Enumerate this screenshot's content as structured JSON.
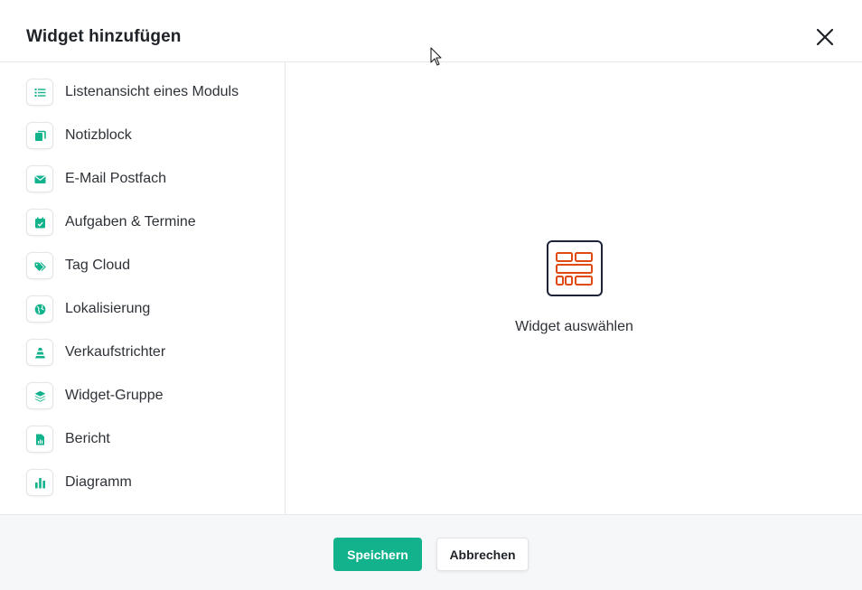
{
  "dialog": {
    "title": "Widget hinzufügen",
    "close_icon": "close-icon"
  },
  "colors": {
    "accent": "#12b28c",
    "widget_icon_orange": "#e04a12",
    "widget_icon_border": "#1d2338"
  },
  "sidebar": {
    "items": [
      {
        "label": "Listenansicht eines Moduls",
        "icon": "list-icon"
      },
      {
        "label": "Notizblock",
        "icon": "notes-icon"
      },
      {
        "label": "E-Mail Postfach",
        "icon": "envelope-icon"
      },
      {
        "label": "Aufgaben & Termine",
        "icon": "calendar-check-icon"
      },
      {
        "label": "Tag Cloud",
        "icon": "tags-icon"
      },
      {
        "label": "Lokalisierung",
        "icon": "globe-icon"
      },
      {
        "label": "Verkaufstrichter",
        "icon": "funnel-icon"
      },
      {
        "label": "Widget-Gruppe",
        "icon": "layers-icon"
      },
      {
        "label": "Bericht",
        "icon": "report-icon"
      },
      {
        "label": "Diagramm",
        "icon": "bar-chart-icon"
      }
    ]
  },
  "main": {
    "placeholder_icon": "widget-layout-icon",
    "placeholder_text": "Widget auswählen"
  },
  "footer": {
    "save_label": "Speichern",
    "cancel_label": "Abbrechen"
  }
}
